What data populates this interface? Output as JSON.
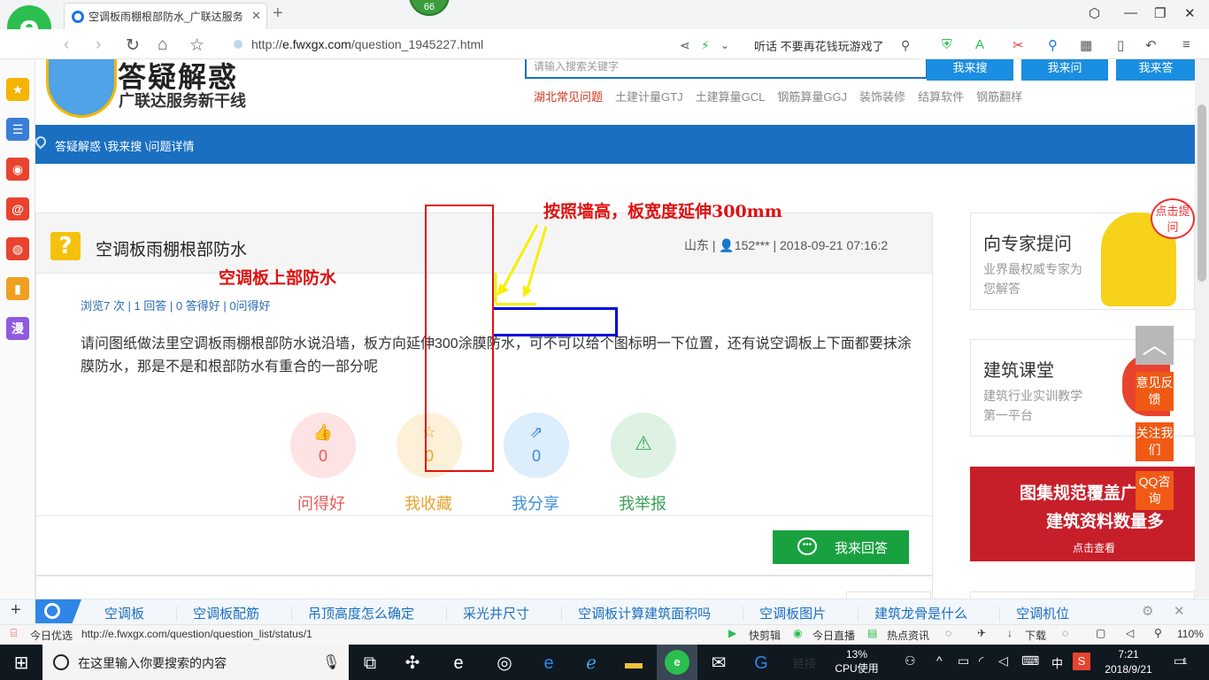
{
  "browser": {
    "tab_title": "空调板雨棚根部防水_广联达服务",
    "tab_close": "✕",
    "new_tab": "+",
    "badge": "66",
    "url_prefix": "http://",
    "url_host": "e.fwxgx.com",
    "url_path": "/question_1945227.html",
    "news_ticker": "听话 不要再花钱玩游戏了",
    "status_left_label": "今日优选",
    "status_url": "http://e.fwxgx.com/question/question_list/status/1",
    "status_items": [
      "快剪辑",
      "今日直播",
      "热点资讯",
      "下载"
    ],
    "zoom": "110%"
  },
  "site": {
    "title": "答疑解惑",
    "slogan": "广联达服务新干线",
    "search_placeholder": "请输入搜索关键字",
    "search_buttons": [
      "我来搜",
      "我来问",
      "我来答"
    ],
    "hot_links": [
      "湖北常见问题",
      "土建计量GTJ",
      "土建算量GCL",
      "钢筋算量GGJ",
      "装饰装修",
      "结算软件",
      "钢筋翻样"
    ],
    "breadcrumb": "答疑解惑 \\我来搜 \\问题详情"
  },
  "question": {
    "title": "空调板雨棚根部防水",
    "province": "山东",
    "user": "152***",
    "datetime": "2018-09-21 07:16:2",
    "stats": "浏览7 次 | 1 回答 | 0 答得好 | 0问得好",
    "body": "请问图纸做法里空调板雨棚根部防水说沿墙，板方向延伸300涂膜防水，可不可以给个图标明一下位置，还有说空调板上下面都要抹涂膜防水，那是不是和根部防水有重合的一部分呢",
    "actions": [
      {
        "label": "问得好",
        "count": "0",
        "color": "#e55b5b",
        "bg": "#fde3e3"
      },
      {
        "label": "我收藏",
        "count": "0",
        "color": "#e6a532",
        "bg": "#fdf0d8"
      },
      {
        "label": "我分享",
        "count": "0",
        "color": "#3b8fd8",
        "bg": "#dcedfb"
      },
      {
        "label": "我举报",
        "count": "",
        "color": "#3aa057",
        "bg": "#ddf2e3"
      }
    ],
    "answer_button": "我来回答"
  },
  "annotations": {
    "text_top": "按照墙高，板宽度延伸300mm",
    "text_left": "空调板上部防水"
  },
  "right": {
    "expert_title": "向专家提问",
    "expert_sub": "业界最权威专家为您解答",
    "course_title": "建筑课堂",
    "course_sub": "建筑行业实训教学第一平台",
    "banner_line1": "图集规范覆盖广",
    "banner_line2": "建筑资料数量多",
    "banner_cta": "点击查看",
    "float_feedback": "意见反馈",
    "float_follow": "关注我们",
    "float_qq": "QQ咨询",
    "mascot_tag": "点击提问"
  },
  "keywords": [
    "空调板",
    "空调板配筋",
    "吊顶高度怎么确定",
    "采光井尺寸",
    "空调板计算建筑面积吗",
    "空调板图片",
    "建筑龙骨是什么",
    "空调机位"
  ],
  "taskbar": {
    "search_placeholder": "在这里输入你要搜索的内容",
    "link_label": "链接",
    "cpu": "13%",
    "cpu_label": "CPU使用",
    "ime": "中",
    "time": "7:21",
    "date": "2018/9/21",
    "notif": "1"
  }
}
